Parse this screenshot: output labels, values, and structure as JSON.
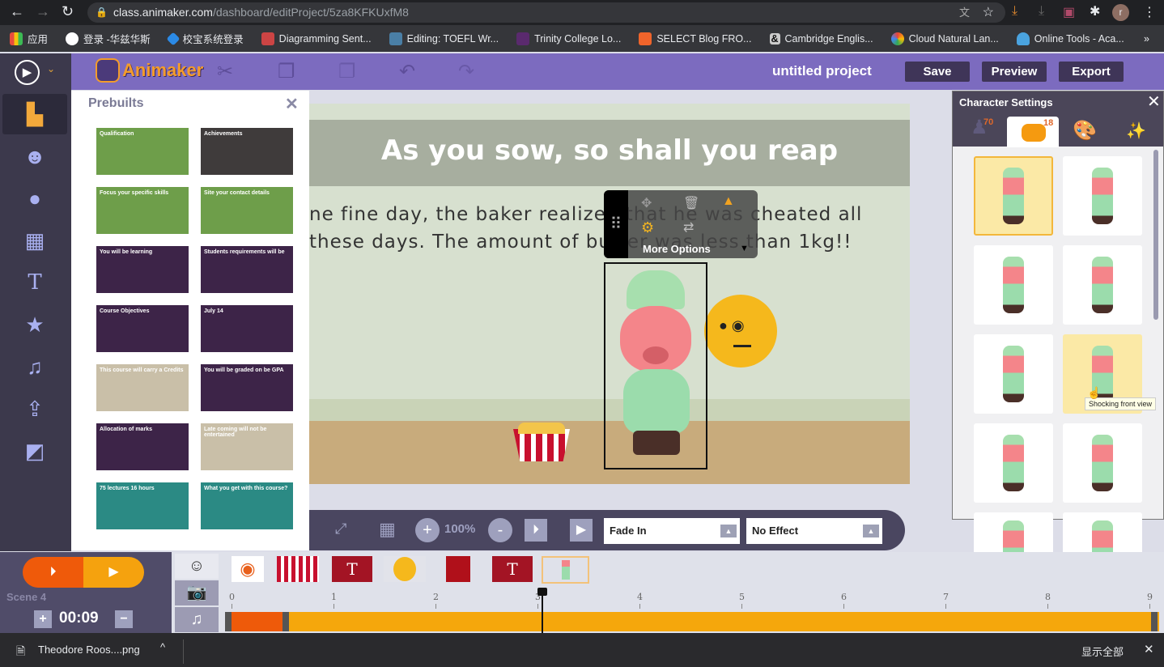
{
  "browser": {
    "url_host": "class.animaker.com",
    "url_path": "/dashboard/editProject/5za8KFKUxfM8",
    "profile_initial": "r",
    "bookmarks": [
      {
        "label": "应用",
        "color": "#e84c3d"
      },
      {
        "label": "登录 -华兹华斯",
        "color": "#ffffff"
      },
      {
        "label": "校宝系统登录",
        "color": "#2b8ae6"
      },
      {
        "label": "Diagramming Sent...",
        "color": "#c44"
      },
      {
        "label": "Editing: TOEFL Wr...",
        "color": "#4a7fa6"
      },
      {
        "label": "Trinity College Lo...",
        "color": "#5a2a6e"
      },
      {
        "label": "SELECT Blog FRO...",
        "color": "#f0642b"
      },
      {
        "label": "Cambridge Englis...",
        "color": "#111111"
      },
      {
        "label": "Cloud Natural Lan...",
        "color": "#4285f4"
      },
      {
        "label": "Online Tools - Aca...",
        "color": "#4aa3df"
      }
    ],
    "more": "»"
  },
  "app": {
    "logo": "Animaker",
    "project_title": "untitled project",
    "save": "Save",
    "preview": "Preview",
    "export": "Export",
    "accent": "#7c6bbf"
  },
  "sidebar": {
    "items": [
      "templates",
      "characters",
      "props",
      "backgrounds",
      "text",
      "effects",
      "music",
      "upload",
      "transitions"
    ]
  },
  "prebuilts": {
    "title": "Prebuilts",
    "close": "✕",
    "thumbs": [
      {
        "text": "Qualification",
        "bg": "#6e9e4a"
      },
      {
        "text": "Achievements",
        "bg": "#3f3b3b"
      },
      {
        "text": "Focus your specific skills",
        "bg": "#6e9e4a"
      },
      {
        "text": "Site your contact details",
        "bg": "#6e9e4a"
      },
      {
        "text": "You will be learning",
        "bg": "#3d2448"
      },
      {
        "text": "Students requirements will be",
        "bg": "#3d2448"
      },
      {
        "text": "Course Objectives",
        "bg": "#3d2448"
      },
      {
        "text": "July 14",
        "bg": "#3d2448"
      },
      {
        "text": "This course will carry a Credits",
        "bg": "#c9bfa8"
      },
      {
        "text": "You will be graded on be GPA",
        "bg": "#3d2448"
      },
      {
        "text": "Allocation of marks",
        "bg": "#3d2448"
      },
      {
        "text": "Late coming will not be entertained",
        "bg": "#c9bfa8"
      },
      {
        "text": "75 lectures 16 hours",
        "bg": "#2b8a84"
      },
      {
        "text": "What you get with this course?",
        "bg": "#2b8a84"
      }
    ]
  },
  "stage": {
    "title": "As you sow, so shall you reap",
    "line1": "ne fine day, the baker realized that he was cheated all",
    "line2": "these days. The amount of butter was less than 1kg!!"
  },
  "toolbar": {
    "more_options": "More Options"
  },
  "controls": {
    "zoom": "100%",
    "enter_effect": "Fade In",
    "exit_effect": "No Effect"
  },
  "character_settings": {
    "title": "Character Settings",
    "tabs": [
      {
        "name": "actions",
        "count": "70"
      },
      {
        "name": "expressions",
        "count": "18",
        "active": true
      },
      {
        "name": "colors"
      },
      {
        "name": "effects"
      }
    ],
    "tooltip": "Shocking front view"
  },
  "timeline": {
    "scene": "Scene 4",
    "duration": "00:09",
    "ticks": [
      "0",
      "1",
      "2",
      "3",
      "4",
      "5",
      "6",
      "7",
      "8",
      "9"
    ],
    "playhead_seconds": 3.1,
    "enter_end_seconds": 0.5
  },
  "downloads": {
    "file": "Theodore Roos....png",
    "show_all": "显示全部"
  }
}
